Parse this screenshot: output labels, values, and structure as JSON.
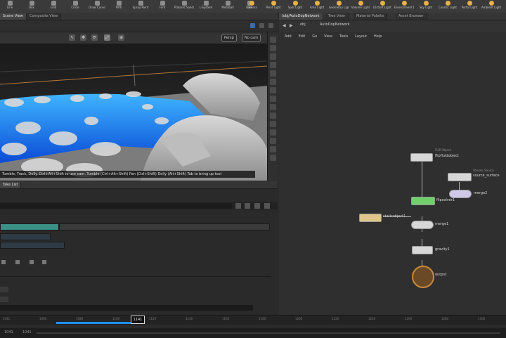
{
  "shelf": {
    "tools": [
      {
        "label": "Line",
        "icon": "line-icon"
      },
      {
        "label": "Box",
        "icon": "box-icon"
      },
      {
        "label": "Grid",
        "icon": "grid-icon"
      },
      {
        "label": "Circle",
        "icon": "circle-icon"
      },
      {
        "label": "Draw Curve",
        "icon": "curve-icon"
      },
      {
        "label": "Path",
        "icon": "path-icon"
      },
      {
        "label": "Spray Paint",
        "icon": "spray-icon"
      },
      {
        "label": "Font",
        "icon": "font-icon"
      },
      {
        "label": "Platonic Solids",
        "icon": "solids-icon"
      },
      {
        "label": "L-System",
        "icon": "lsystem-icon"
      },
      {
        "label": "Metaball",
        "icon": "metaball-icon"
      },
      {
        "label": "File",
        "icon": "file-icon"
      }
    ],
    "lights": [
      {
        "label": "Camera",
        "icon": "camera-icon"
      },
      {
        "label": "Point Light",
        "icon": "point-light-icon"
      },
      {
        "label": "Spot Light",
        "icon": "spot-light-icon"
      },
      {
        "label": "Area Light",
        "icon": "area-light-icon"
      },
      {
        "label": "Geometry Light",
        "icon": "geo-light-icon"
      },
      {
        "label": "Volume Light",
        "icon": "volume-light-icon"
      },
      {
        "label": "Distant Light",
        "icon": "distant-light-icon"
      },
      {
        "label": "Environment Light",
        "icon": "env-light-icon"
      },
      {
        "label": "Sky Light",
        "icon": "sky-light-icon"
      },
      {
        "label": "Caustic Light",
        "icon": "caustic-light-icon"
      },
      {
        "label": "Portal Light",
        "icon": "portal-light-icon"
      },
      {
        "label": "Ambient Light",
        "icon": "ambient-light-icon"
      }
    ]
  },
  "left_tabs": [
    "Scene View",
    "Composite View"
  ],
  "right_tabs": [
    "/obj/AutoDopNetwork",
    "Tree View",
    "Material Palette",
    "Asset Browser"
  ],
  "viewport": {
    "camera_menu": "Persp",
    "cam_menu": "No cam",
    "hud": "Tumble, Track, Dolly. Ctrl+Alt+Shift to use cam. Tumble (Ctrl+Alt+Shift) Pan (Ctrl+Shift) Dolly (Alt+Shift) Tab to bring up tool"
  },
  "lower_panel": {
    "tab": "Take List"
  },
  "network": {
    "path": [
      "obj",
      "AutoDopNetwork"
    ],
    "menu": [
      "Add",
      "Edit",
      "Go",
      "View",
      "Tools",
      "Layout",
      "Help"
    ],
    "nodes": [
      {
        "name": "flipfluidobject",
        "sub": "FLIP Object"
      },
      {
        "name": "source_surface",
        "sub": "Volume Source"
      },
      {
        "name": "merge2",
        "sub": ""
      },
      {
        "name": "flipsolver1",
        "sub": ""
      },
      {
        "name": "staticobject1",
        "sub": ""
      },
      {
        "name": "merge1",
        "sub": ""
      },
      {
        "name": "gravity1",
        "sub": ""
      },
      {
        "name": "output",
        "sub": ""
      }
    ]
  },
  "timeline": {
    "ticks": [
      "1041",
      "1060",
      "1080",
      "1100",
      "1120",
      "1140",
      "1160",
      "1180",
      "1200",
      "1220",
      "1240",
      "1260",
      "1280",
      "1300"
    ],
    "current_frame": "1141",
    "start": "1041",
    "end": "1041"
  },
  "colors": {
    "accent": "#1e8fff",
    "node_green": "#6fd06a",
    "node_orange": "#c88a3a"
  }
}
